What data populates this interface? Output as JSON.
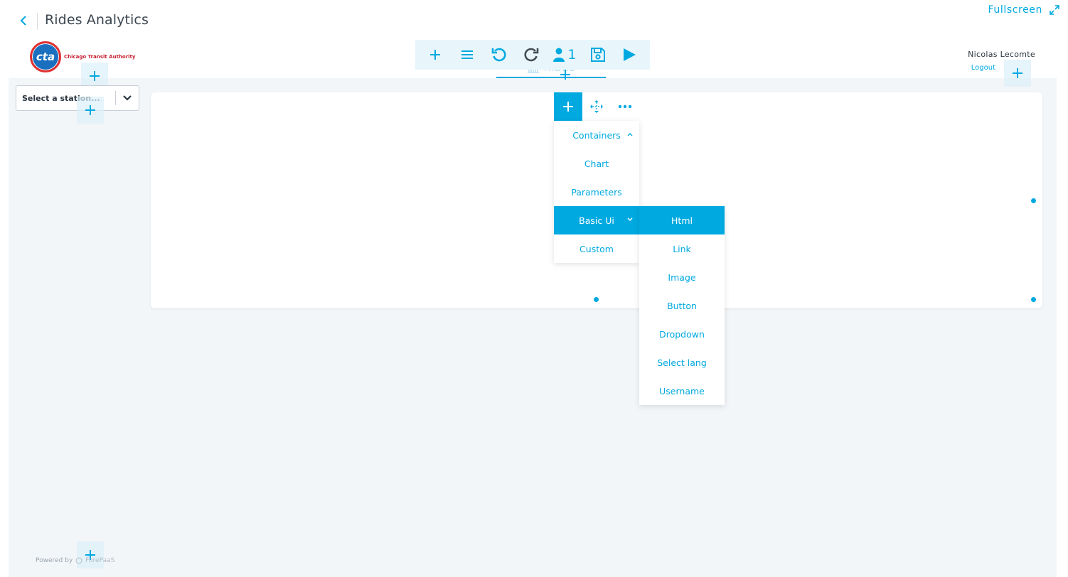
{
  "header": {
    "title": "Rides Analytics",
    "fullscreen_label": "Fullscreen"
  },
  "logo": {
    "mark": "cta",
    "text": "Chicago Transit Authority"
  },
  "toolbar": {
    "users_count": "1",
    "icons": [
      "plus-icon",
      "menu-icon",
      "undo-icon",
      "redo-icon",
      "user-icon",
      "save-icon",
      "play-icon"
    ]
  },
  "tab": {
    "label": "RIDES"
  },
  "user": {
    "name": "Nicolas Lecomte",
    "logout_label": "Logout"
  },
  "filters": {
    "station_placeholder": "Select a station..."
  },
  "add_menu": {
    "items": [
      "Containers",
      "Chart",
      "Parameters",
      "Basic Ui",
      "Custom"
    ],
    "active": "Basic Ui"
  },
  "basic_ui_menu": {
    "items": [
      "Html",
      "Link",
      "Image",
      "Button",
      "Dropdown",
      "Select lang",
      "Username"
    ],
    "active": "Html"
  },
  "footer": {
    "powered_by": "Powered by",
    "brand": "ForePaaS"
  },
  "colors": {
    "accent": "#00a9e0",
    "canvas_bg": "#f3f6f9"
  }
}
